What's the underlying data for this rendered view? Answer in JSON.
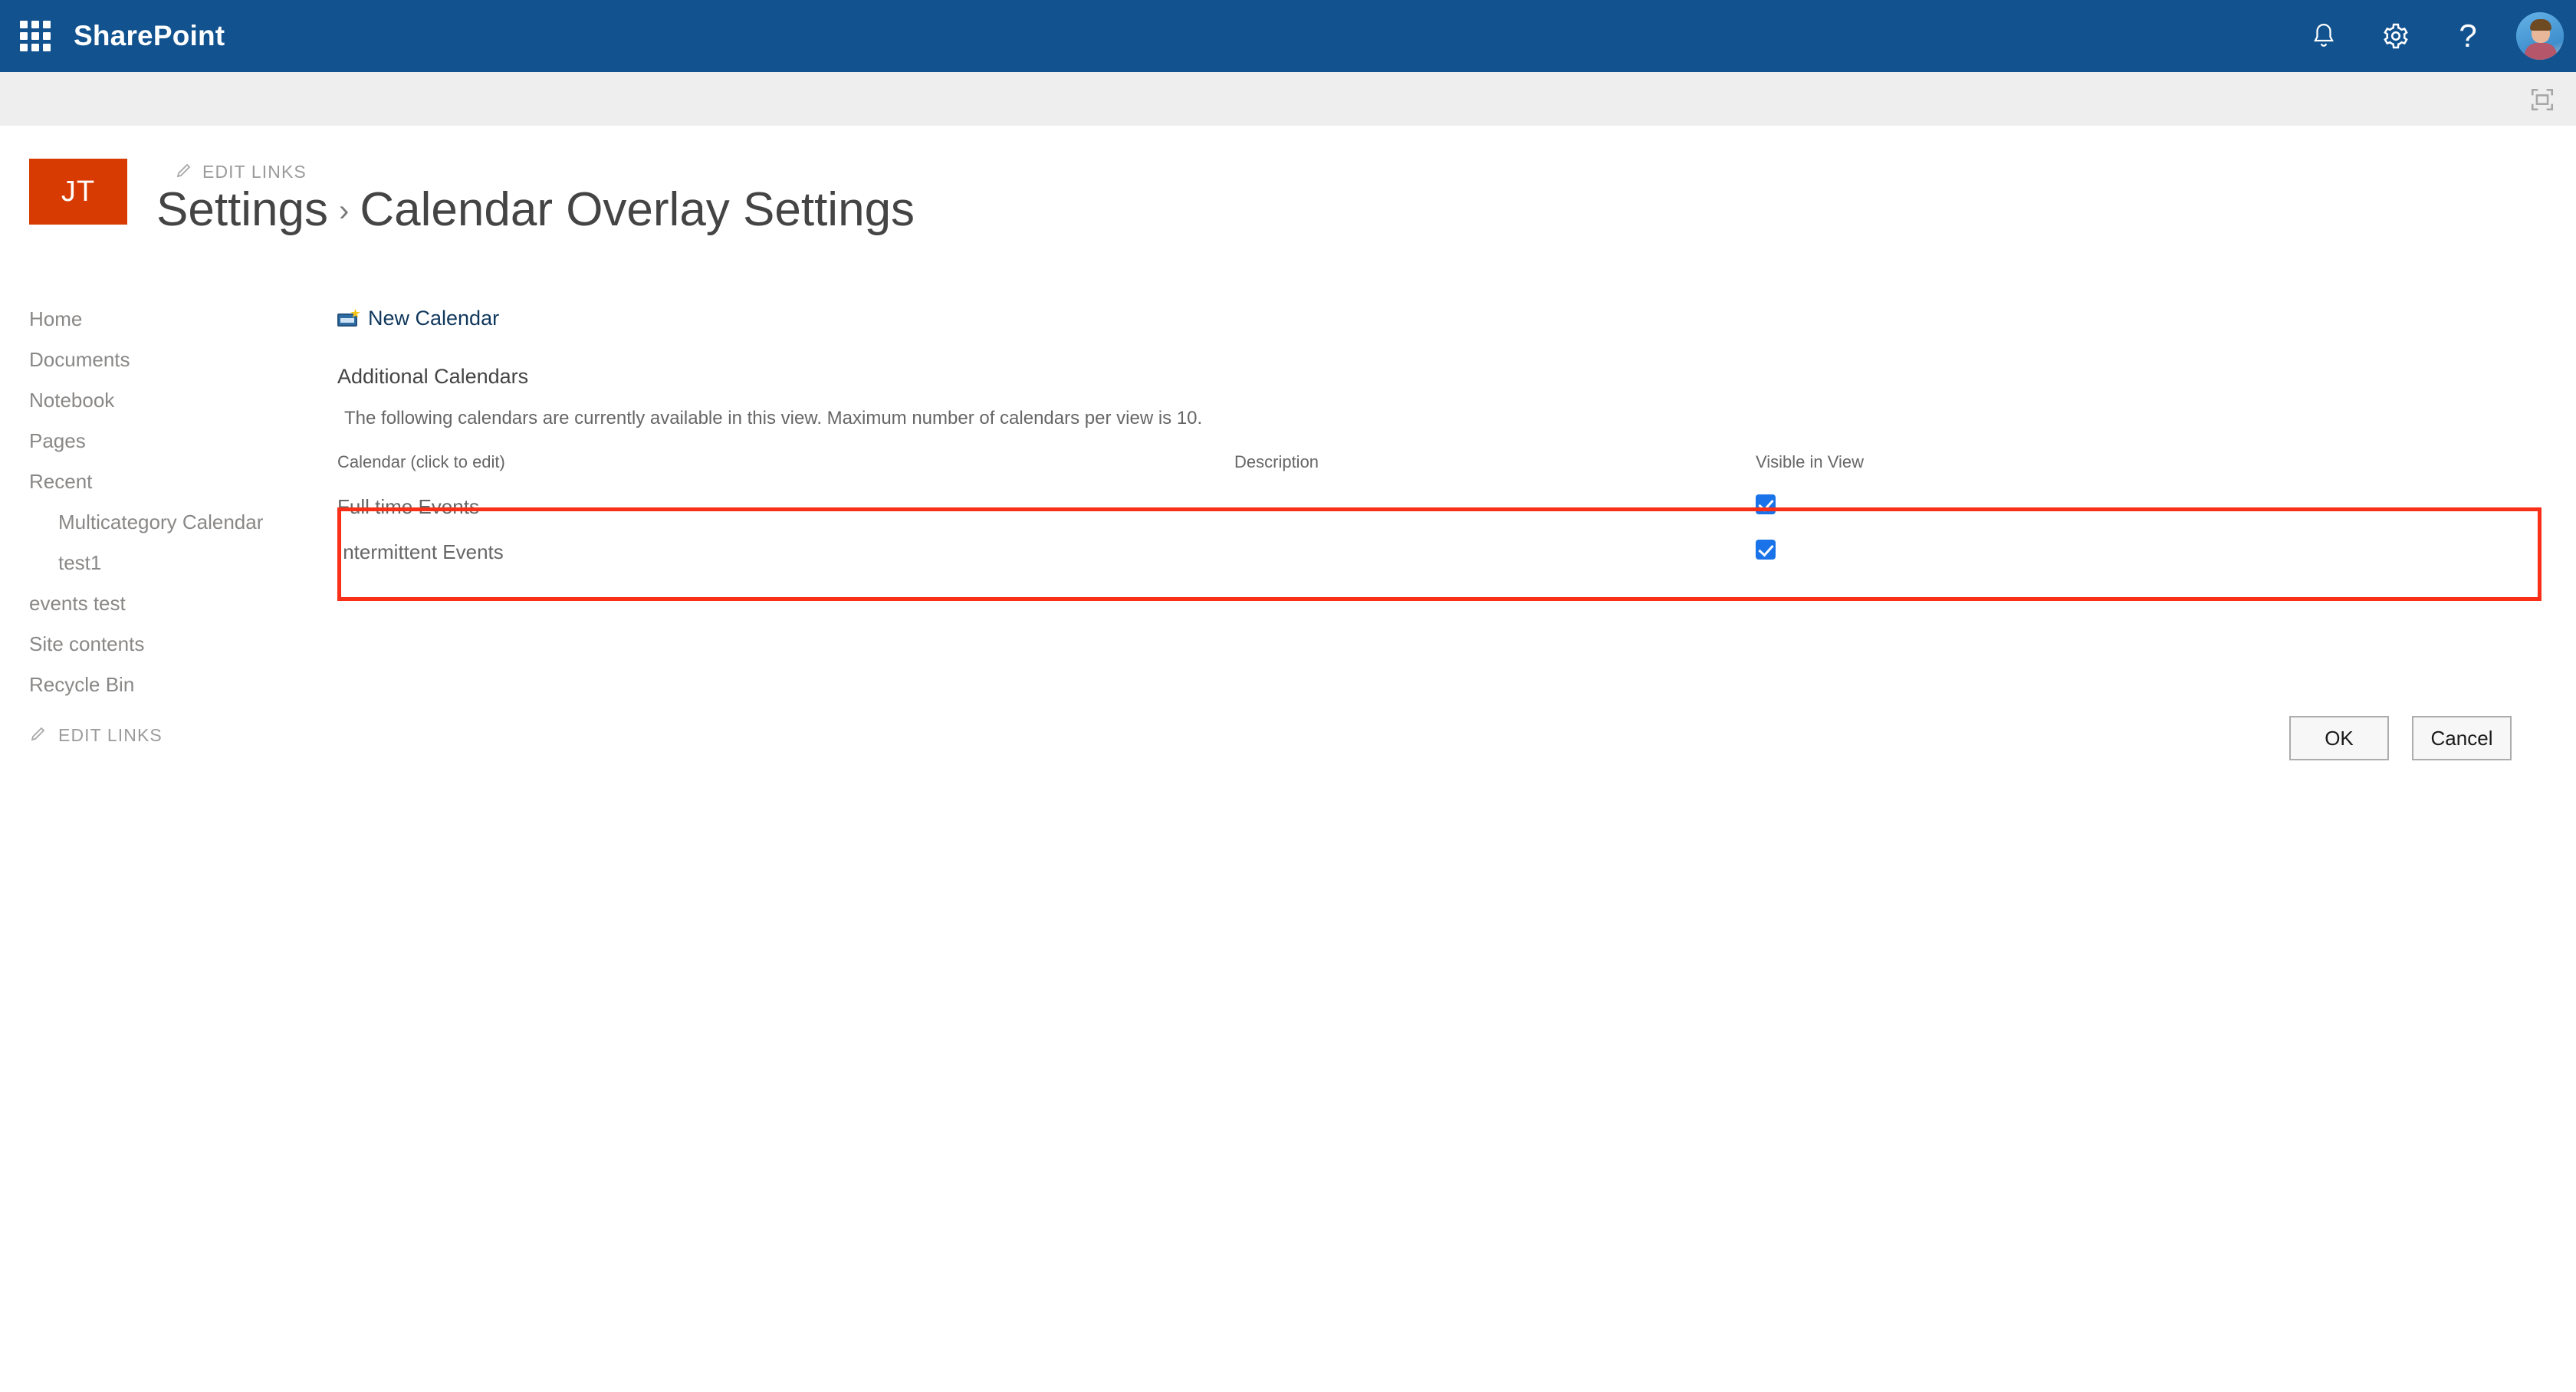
{
  "suite": {
    "app_name": "SharePoint",
    "waffle_icon": "app-launcher-waffle-icon",
    "notifications_icon": "bell-icon",
    "settings_icon": "gear-icon",
    "help_icon": "question-mark-icon",
    "avatar_icon": "user-avatar",
    "focus_icon": "focus-on-content-icon"
  },
  "site": {
    "logo_initials": "JT",
    "edit_links_top": "EDIT LINKS",
    "edit_links_bottom": "EDIT LINKS",
    "breadcrumb": {
      "parent": "Settings",
      "separator": "›",
      "current": "Calendar Overlay Settings"
    }
  },
  "sidebar": {
    "items": [
      {
        "label": "Home",
        "indent": false
      },
      {
        "label": "Documents",
        "indent": false
      },
      {
        "label": "Notebook",
        "indent": false
      },
      {
        "label": "Pages",
        "indent": false
      },
      {
        "label": "Recent",
        "indent": false
      },
      {
        "label": "Multicategory Calendar",
        "indent": true
      },
      {
        "label": "test1",
        "indent": true
      },
      {
        "label": "events test",
        "indent": false
      },
      {
        "label": "Site contents",
        "indent": false
      },
      {
        "label": "Recycle Bin",
        "indent": false
      }
    ]
  },
  "main": {
    "new_calendar_label": "New Calendar",
    "section_title": "Additional Calendars",
    "section_description": "The following calendars are currently available in this view. Maximum number of calendars per view is 10.",
    "table": {
      "headers": {
        "calendar": "Calendar (click to edit)",
        "description": "Description",
        "visible": "Visible in View"
      },
      "rows": [
        {
          "calendar": "Full time Events",
          "description": "",
          "visible": true
        },
        {
          "calendar": "Intermittent Events",
          "description": "",
          "visible": true
        }
      ]
    }
  },
  "footer": {
    "ok_label": "OK",
    "cancel_label": "Cancel"
  },
  "colors": {
    "suite_bar": "#11528f",
    "site_logo": "#d83b01",
    "annotation": "#f92f18",
    "checkbox": "#1a73e8",
    "breadcrumb_text": "#444444"
  }
}
